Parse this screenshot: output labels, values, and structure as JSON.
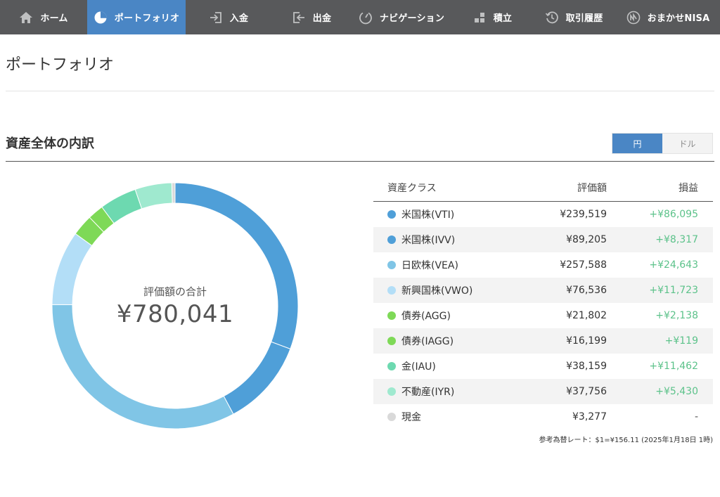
{
  "nav": {
    "items": [
      {
        "label": "ホーム",
        "icon": "home-icon"
      },
      {
        "label": "ポートフォリオ",
        "icon": "pie-chart-icon",
        "active": true
      },
      {
        "label": "入金",
        "icon": "deposit-icon"
      },
      {
        "label": "出金",
        "icon": "withdraw-icon"
      },
      {
        "label": "ナビゲーション",
        "icon": "navigation-icon"
      },
      {
        "label": "積立",
        "icon": "accumulation-icon"
      },
      {
        "label": "取引履歴",
        "icon": "history-icon"
      },
      {
        "label": "おまかせNISA",
        "icon": "nisa-icon"
      }
    ]
  },
  "page": {
    "title": "ポートフォリオ"
  },
  "section": {
    "title": "資産全体の内訳",
    "currency_toggle": {
      "yen": "円",
      "dollar": "ドル",
      "selected": "円"
    }
  },
  "donut": {
    "total_label": "評価額の合計",
    "total_value": "¥780,041"
  },
  "table": {
    "headers": {
      "asset_class": "資産クラス",
      "value": "評価額",
      "profit_loss": "損益"
    },
    "rows": [
      {
        "name": "米国株(VTI)",
        "value": "¥239,519",
        "pl": "+¥86,095",
        "color": "#4f9fd8"
      },
      {
        "name": "米国株(IVV)",
        "value": "¥89,205",
        "pl": "+¥8,317",
        "color": "#4f9fd8"
      },
      {
        "name": "日欧株(VEA)",
        "value": "¥257,588",
        "pl": "+¥24,643",
        "color": "#80c5e6"
      },
      {
        "name": "新興国株(VWO)",
        "value": "¥76,536",
        "pl": "+¥11,723",
        "color": "#b3def7"
      },
      {
        "name": "債券(AGG)",
        "value": "¥21,802",
        "pl": "+¥2,138",
        "color": "#7ed957"
      },
      {
        "name": "債券(IAGG)",
        "value": "¥16,199",
        "pl": "+¥119",
        "color": "#7ed957"
      },
      {
        "name": "金(IAU)",
        "value": "¥38,159",
        "pl": "+¥11,462",
        "color": "#6dd9b0"
      },
      {
        "name": "不動産(IYR)",
        "value": "¥37,756",
        "pl": "+¥5,430",
        "color": "#9fe9cf"
      },
      {
        "name": "現金",
        "value": "¥3,277",
        "pl": "-",
        "color": "#d9d9d9"
      }
    ]
  },
  "exchange_note": "参考為替レート：$1=¥156.11 (2025年1月18日 1時)",
  "chart_data": {
    "type": "pie",
    "categories": [
      "米国株(VTI)",
      "米国株(IVV)",
      "日欧株(VEA)",
      "新興国株(VWO)",
      "債券(AGG)",
      "債券(IAGG)",
      "金(IAU)",
      "不動産(IYR)",
      "現金"
    ],
    "values": [
      239519,
      89205,
      257588,
      76536,
      21802,
      16199,
      38159,
      37756,
      3277
    ],
    "colors": [
      "#4f9fd8",
      "#4f9fd8",
      "#80c5e6",
      "#b3def7",
      "#7ed957",
      "#7ed957",
      "#6dd9b0",
      "#9fe9cf",
      "#d9d9d9"
    ]
  }
}
